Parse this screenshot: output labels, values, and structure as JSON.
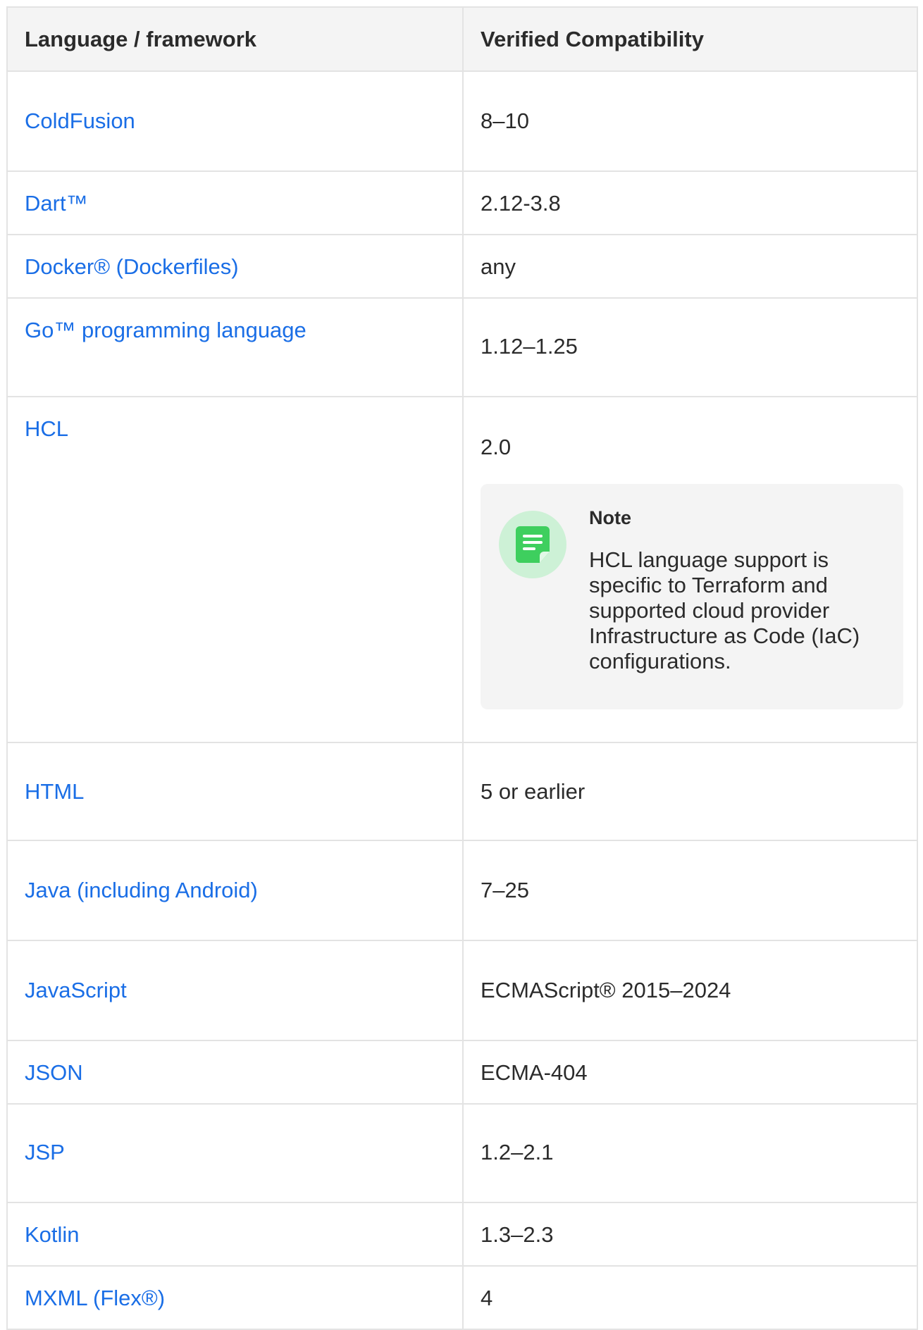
{
  "table": {
    "headers": [
      "Language / framework",
      "Verified Compatibility"
    ],
    "rows": [
      {
        "language": "ColdFusion",
        "compat": "8–10"
      },
      {
        "language": "Dart™",
        "compat": "2.12-3.8"
      },
      {
        "language": "Docker® (Dockerfiles)",
        "compat": "any"
      },
      {
        "language": "Go™ programming language",
        "compat": "1.12–1.25"
      },
      {
        "language": "HCL",
        "compat": "2.0"
      },
      {
        "language": "HTML",
        "compat": "5 or earlier"
      },
      {
        "language": "Java (including Android)",
        "compat": "7–25"
      },
      {
        "language": "JavaScript",
        "compat": "ECMAScript® 2015–2024"
      },
      {
        "language": "JSON",
        "compat": "ECMA-404"
      },
      {
        "language": "JSP",
        "compat": "1.2–2.1"
      },
      {
        "language": "Kotlin",
        "compat": "1.3–2.3"
      },
      {
        "language": "MXML (Flex®)",
        "compat": "4"
      }
    ]
  },
  "note": {
    "title": "Note",
    "body": "HCL language support is specific to Terraform and supported cloud provider Infrastructure as Code (IaC) configurations.",
    "icon": "note-icon",
    "accent": "#3ecf5e",
    "icon_bg": "#cdf1d6"
  },
  "colors": {
    "link": "#1a6ee6",
    "header_bg": "#f4f4f4",
    "border": "#e3e3e3",
    "text": "#2b2b2b"
  }
}
